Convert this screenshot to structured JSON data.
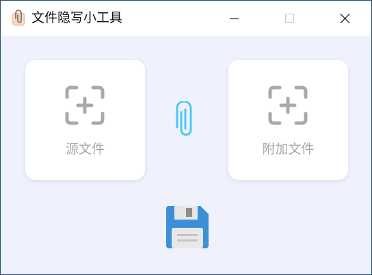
{
  "window": {
    "title": "文件隐写小工具",
    "icon": "paperclip-app-icon",
    "controls": {
      "minimize": "minimize-icon",
      "maximize": "maximize-icon",
      "close": "close-icon"
    }
  },
  "main": {
    "source_card": {
      "label": "源文件",
      "icon": "add-scan-icon"
    },
    "attach_card": {
      "label": "附加文件",
      "icon": "add-scan-icon"
    },
    "link_icon": "paperclip-icon",
    "save_icon": "floppy-disk-icon"
  },
  "colors": {
    "background": "#eff1fd",
    "card": "#ffffff",
    "icon_gray": "#a9a9a9",
    "clip_blue": "#4dc8ee",
    "floppy_blue": "#3d8fd8"
  }
}
